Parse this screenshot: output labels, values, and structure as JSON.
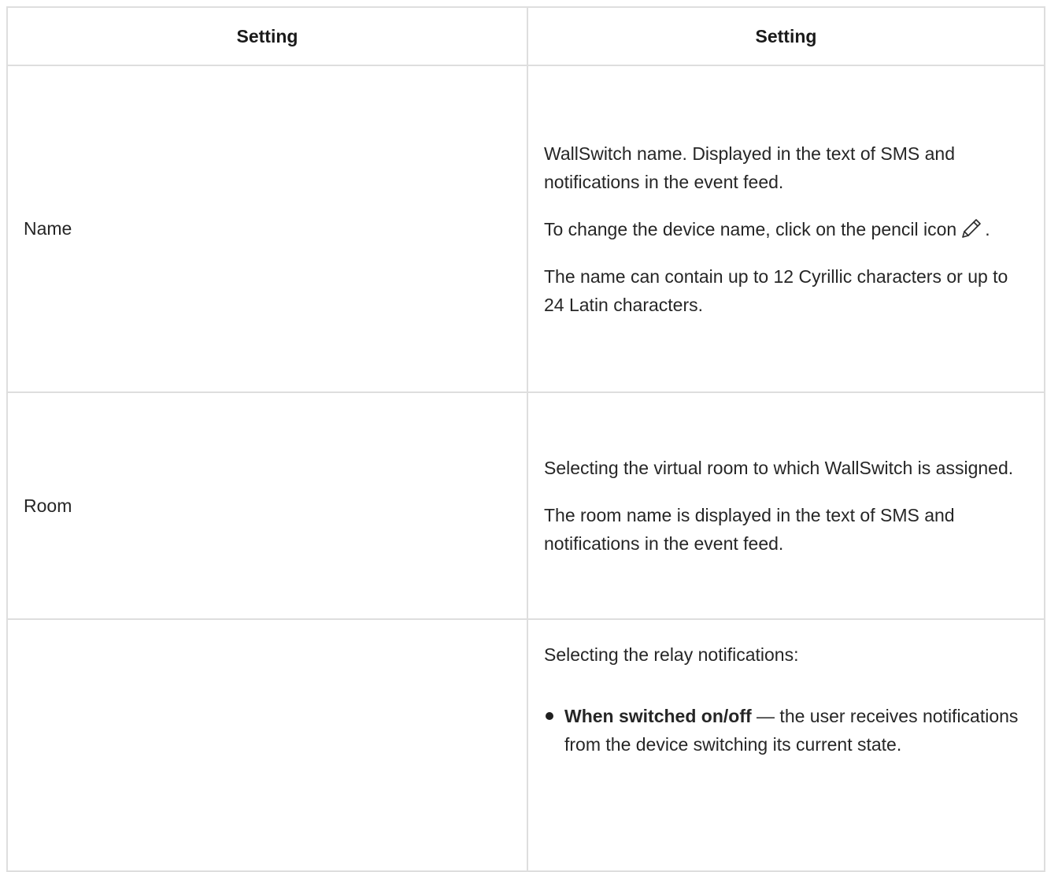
{
  "table": {
    "headers": [
      "Setting",
      "Setting"
    ],
    "rows": [
      {
        "name": "Name",
        "paragraphs": [
          "WallSwitch name. Displayed in the text of SMS and notifications in the event feed.",
          "To change the device name, click on the pencil icon",
          "The name can contain up to 12 Cyrillic characters or up to 24 Latin characters."
        ],
        "pencil_suffix": ".",
        "icon": "pencil-icon"
      },
      {
        "name": "Room",
        "paragraphs": [
          "Selecting the virtual room to which WallSwitch is assigned.",
          "The room name is displayed in the text of SMS and notifications in the event feed."
        ]
      },
      {
        "name": "",
        "intro": "Selecting the relay notifications:",
        "bullets": [
          {
            "term": "When switched on/off",
            "text": " — the user receives notifications from the device switching its current state."
          }
        ]
      }
    ]
  }
}
